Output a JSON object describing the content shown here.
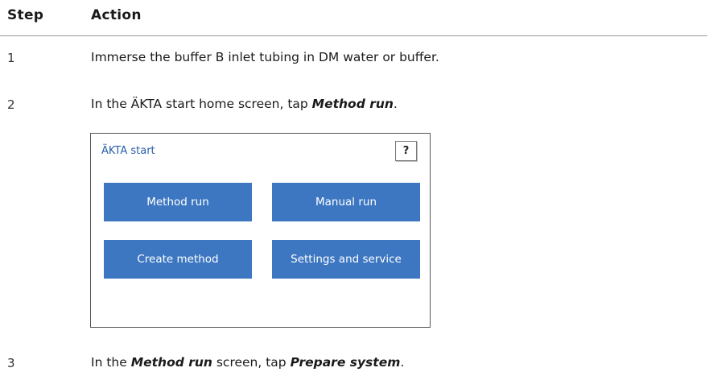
{
  "table": {
    "header": {
      "step": "Step",
      "action": "Action"
    },
    "rows": [
      {
        "num": "1",
        "text": "Immerse the buffer B inlet tubing in DM water or buffer."
      },
      {
        "num": "2",
        "pre": "In the ÄKTA start home screen, tap ",
        "bold": "Method run",
        "post": "."
      },
      {
        "num": "3",
        "pre": "In the ",
        "bold": "Method run",
        "mid": " screen, tap ",
        "bold2": "Prepare system",
        "post": "."
      }
    ]
  },
  "screen": {
    "title": "ÄKTA start",
    "help_label": "?",
    "buttons": {
      "method_run": "Method run",
      "manual_run": "Manual run",
      "create_method": "Create method",
      "settings_service": "Settings and service"
    }
  },
  "colors": {
    "accent": "#3d77c2",
    "title_blue": "#2a5fa8"
  }
}
